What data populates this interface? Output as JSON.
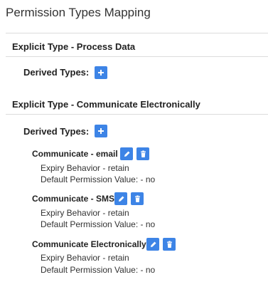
{
  "page": {
    "title": "Permission Types Mapping"
  },
  "sections": [
    {
      "explicit_label": "Explicit Type - Process Data",
      "derived_label": "Derived Types:"
    },
    {
      "explicit_label": "Explicit Type - Communicate Electronically",
      "derived_label": "Derived Types:",
      "items": [
        {
          "name": "Communicate - email",
          "expiry": "Expiry Behavior - retain",
          "default": "Default Permission Value: - no"
        },
        {
          "name": "Communicate - SMS",
          "expiry": "Expiry Behavior - retain",
          "default": "Default Permission Value: - no"
        },
        {
          "name": "Communicate Electronically",
          "expiry": "Expiry Behavior - retain",
          "default": "Default Permission Value: - no"
        }
      ]
    }
  ],
  "icons": {
    "add": "plus-icon",
    "edit": "pencil-icon",
    "delete": "trash-icon"
  },
  "colors": {
    "button": "#3d84e6",
    "divider": "#dcdcdc"
  }
}
